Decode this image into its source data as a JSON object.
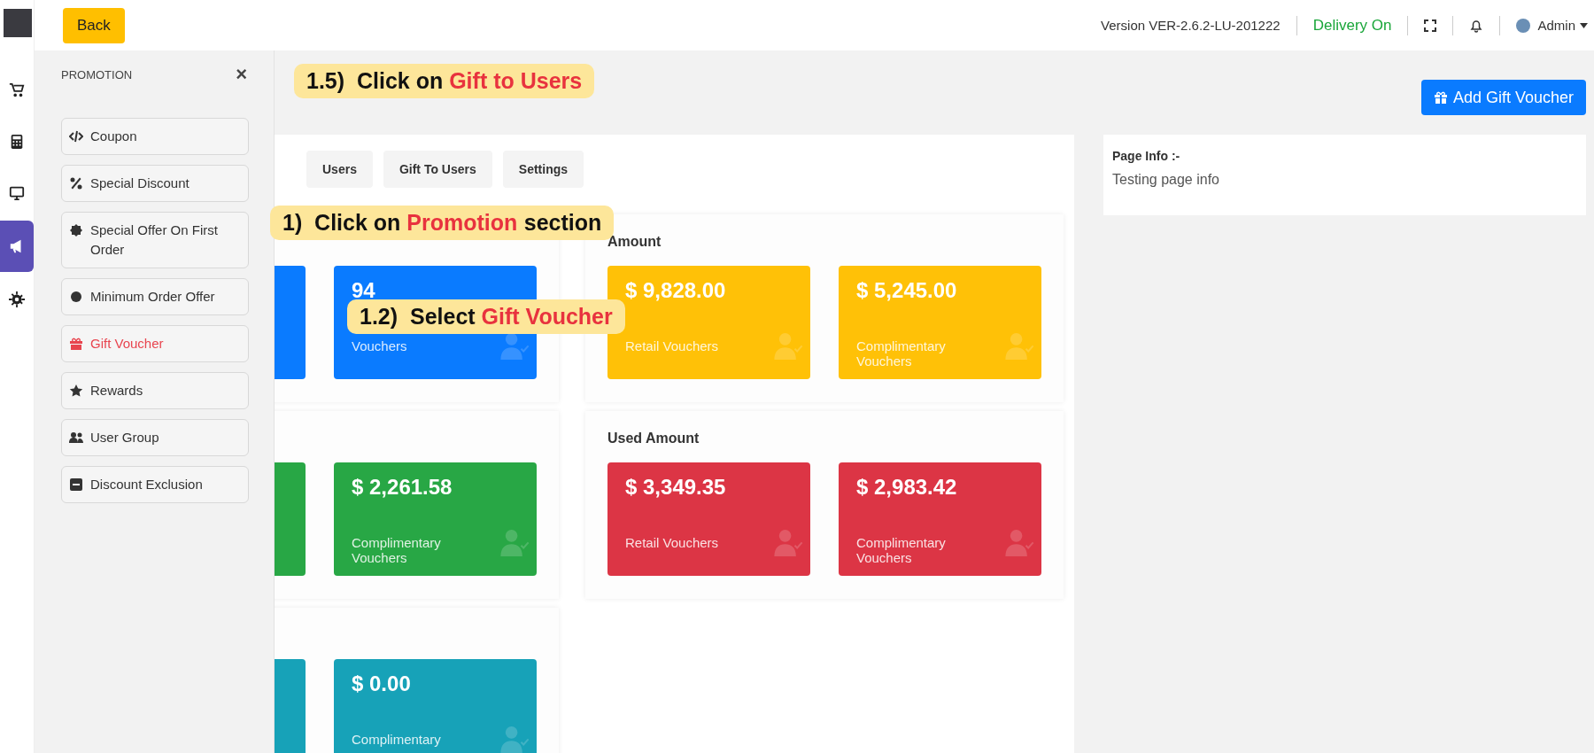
{
  "rail": [
    {
      "selected": false
    },
    {
      "selected": false
    },
    {
      "selected": false
    },
    {
      "selected": true
    },
    {
      "selected": false
    }
  ],
  "topbar": {
    "back": "Back",
    "version": "Version VER-2.6.2-LU-201222",
    "delivery": "Delivery On",
    "user": "Admin"
  },
  "promotion_panel": {
    "title": "PROMOTION",
    "close": "×",
    "items": [
      {
        "label": "Coupon",
        "selected": false
      },
      {
        "label": "Special Discount",
        "selected": false
      },
      {
        "label": "Special Offer On First Order",
        "selected": false
      },
      {
        "label": "Minimum Order Offer",
        "selected": false
      },
      {
        "label": "Gift Voucher",
        "selected": true
      },
      {
        "label": "Rewards",
        "selected": false
      },
      {
        "label": "User Group",
        "selected": false
      },
      {
        "label": "Discount Exclusion",
        "selected": false
      }
    ]
  },
  "add_button": "Add Gift Voucher",
  "tabs": [
    "Users",
    "Gift To Users",
    "Settings"
  ],
  "sections": [
    {
      "color": "#0a7bff",
      "cards": [
        {
          "kind": "covered"
        },
        {
          "kind": "stat",
          "value": "94",
          "label": "Vouchers"
        }
      ]
    },
    {
      "title": "Amount",
      "color": "#ffc107",
      "cards": [
        {
          "value": "$ 9,828.00",
          "label": "Retail Vouchers"
        },
        {
          "value": "$ 5,245.00",
          "label": "Complimentary Vouchers"
        }
      ]
    },
    {
      "color": "#28a745",
      "cards": [
        {
          "kind": "covered"
        },
        {
          "kind": "stat",
          "value": "$ 2,261.58",
          "label": "Complimentary Vouchers"
        }
      ]
    },
    {
      "title": "Used Amount",
      "color": "#dc3545",
      "cards": [
        {
          "value": "$ 3,349.35",
          "label": "Retail Vouchers"
        },
        {
          "value": "$ 2,983.42",
          "label": "Complimentary Vouchers"
        }
      ]
    },
    {
      "color": "#17a2b8",
      "cards": [
        {
          "kind": "covered"
        },
        {
          "kind": "stat",
          "value": "$ 0.00",
          "label": "Complimentary"
        }
      ]
    }
  ],
  "page_info": {
    "title": "Page Info :-",
    "text": "Testing page info"
  },
  "callouts": [
    {
      "step": "1.5)",
      "text": "Click on",
      "highlight": "Gift to Users"
    },
    {
      "step": "1)",
      "text": "Click on",
      "highlight": "Promotion",
      "after": "section"
    },
    {
      "step": "1.2)",
      "text": "Select",
      "highlight": "Gift Voucher"
    }
  ]
}
